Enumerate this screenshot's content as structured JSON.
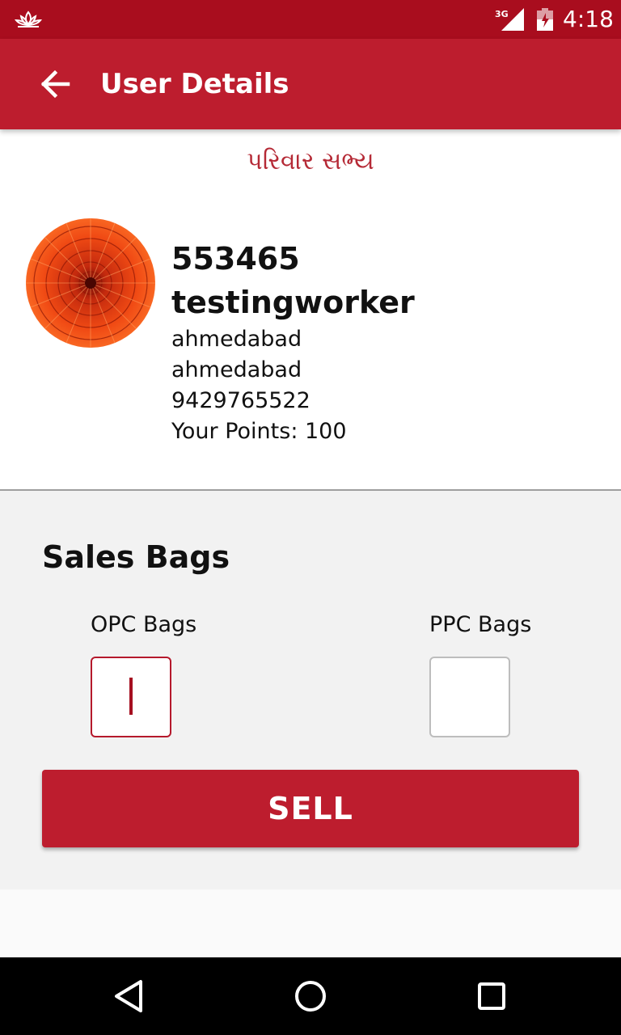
{
  "status_bar": {
    "network": "3G",
    "time": "4:18"
  },
  "app_bar": {
    "title": "User Details",
    "back_icon": "arrow-back-icon"
  },
  "profile": {
    "heading": "પરિવાર સભ્ય",
    "user_id": "553465",
    "name": "testingworker",
    "city": "ahmedabad",
    "district": "ahmedabad",
    "phone": "9429765522",
    "points_text": "Your Points: 100"
  },
  "sales": {
    "title": "Sales Bags",
    "opc_label": "OPC Bags",
    "opc_value": "",
    "ppc_label": "PPC Bags",
    "ppc_value": "",
    "sell_label": "SELL"
  },
  "colors": {
    "status_bar": "#a90d1e",
    "app_bar": "#bd1d2e",
    "accent": "#bd1d2e",
    "heading_text": "#b52a36"
  },
  "nav_bar": {
    "back_icon": "triangle-back-icon",
    "home_icon": "circle-home-icon",
    "recent_icon": "square-recents-icon"
  }
}
